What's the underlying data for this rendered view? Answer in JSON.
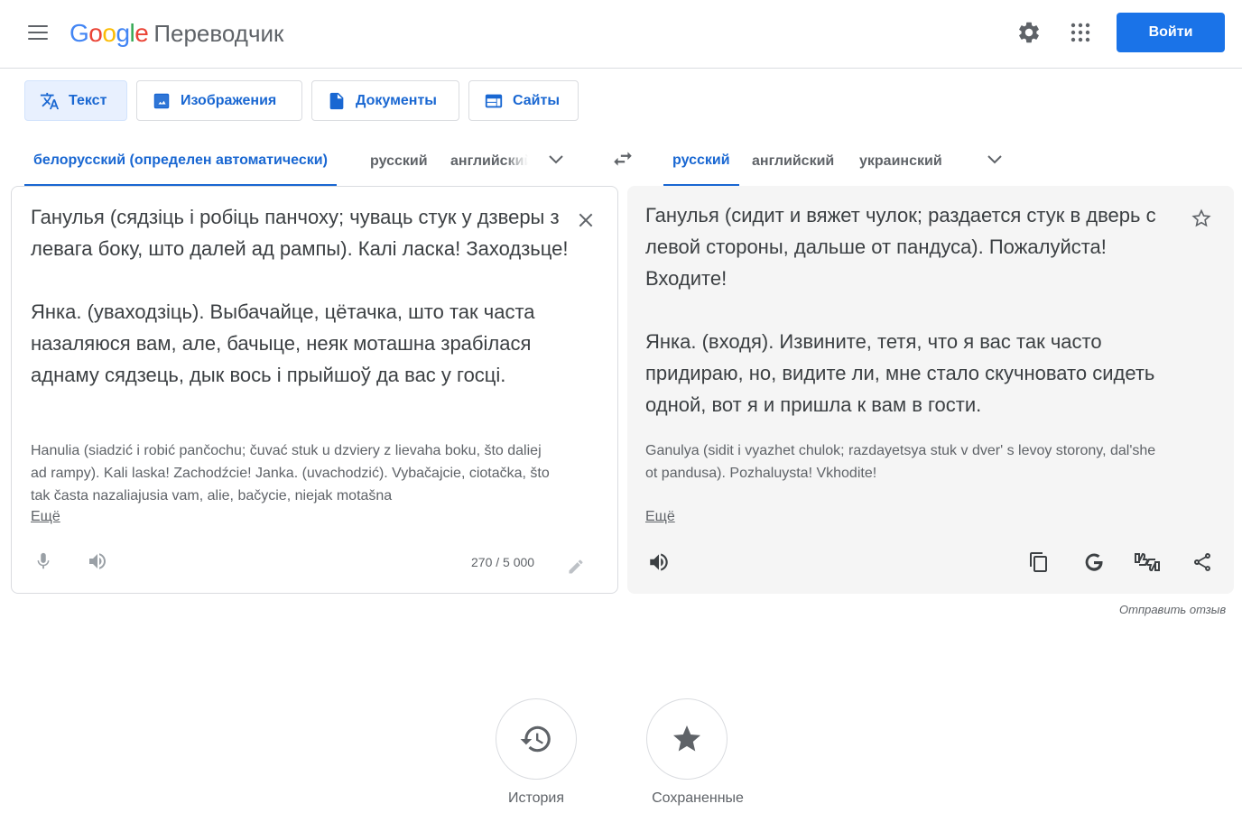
{
  "header": {
    "logo_google": [
      "G",
      "o",
      "o",
      "g",
      "l",
      "e"
    ],
    "product_name": "Переводчик",
    "signin_label": "Войти"
  },
  "mode_tabs": [
    {
      "label": "Текст",
      "icon": "translate-icon",
      "active": true
    },
    {
      "label": "Изображения",
      "icon": "image-icon",
      "active": false
    },
    {
      "label": "Документы",
      "icon": "document-icon",
      "active": false
    },
    {
      "label": "Сайты",
      "icon": "website-icon",
      "active": false
    }
  ],
  "source_langs": {
    "detected": "белорусский (определен автоматически)",
    "lang2": "русский",
    "lang3": "английский"
  },
  "target_langs": {
    "lang1": "русский",
    "lang2": "английский",
    "lang3": "украинский"
  },
  "source": {
    "text": "Ганулья (сядзіць і робіць панчоху; чуваць стук у дзверы з левага боку, што далей ад рампы). Калі ласка! Заходзьце!\n\nЯнка. (уваходзіць). Выбачайце, цётачка, што так часта назаляюся вам, але, бачыце, неяк моташна зрабілася аднаму сядзець, дык вось і прыйшоў да вас у госці.",
    "transliteration": "Hanulia (siadzić i robić pančochu; čuvać stuk u dzviery z lievaha boku, što daliej ad rampy). Kali laska! Zachodźcie! Janka. (uvachodzić). Vybačajcie, ciotačka, što tak časta nazaliajusia vam, alie, bačycie, niejak motašna",
    "more_label": "Ещё",
    "char_count": "270 / 5 000"
  },
  "target": {
    "text": "Ганулья (сидит и вяжет чулок; раздается стук в дверь с левой стороны, дальше от пандуса). Пожалуйста! Входите!\n\nЯнка. (входя). Извините, тетя, что я вас так часто придираю, но, видите ли, мне стало скучновато сидеть одной, вот я и пришла к вам в гости.",
    "transliteration": "Ganulya (sidit i vyazhet chulok; razdayetsya stuk v dver' s levoy storony, dal'she ot pandusa). Pozhaluysta! Vkhodite!",
    "more_label": "Ещё"
  },
  "feedback_label": "Отправить отзыв",
  "bottom": {
    "history_label": "История",
    "saved_label": "Сохраненные"
  },
  "colors": {
    "accent": "#1a73e8",
    "active_tab_text": "#1967d2",
    "active_tab_bg": "#e8f0fe"
  }
}
